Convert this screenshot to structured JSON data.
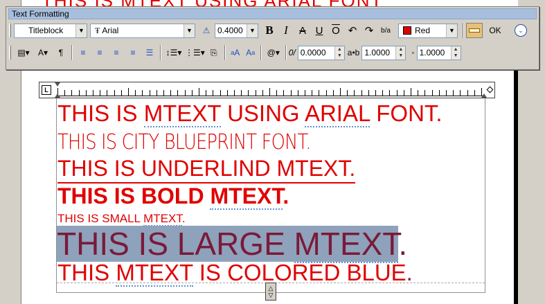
{
  "toolbar": {
    "title": "Text Formatting",
    "style_value": "Titleblock",
    "font_icon": "truetype-icon",
    "font_value": "Arial",
    "height_value": "0.4000",
    "bold": "B",
    "italic": "I",
    "strike": "A",
    "underline": "U",
    "overline": "O",
    "undo_icon": "undo-icon",
    "redo_icon": "redo-icon",
    "stack": "b/a",
    "color_value": "Red",
    "color_hex": "#e00000",
    "ok_label": "OK",
    "oblique_value": "0.0000",
    "tracking_label": "a•b",
    "tracking_value": "1.0000",
    "width_value": "1.0000",
    "uppercase_glyph": "A",
    "lowercase_glyph": "A",
    "symbol_glyph": "@"
  },
  "ruler": {
    "indent_label": "L"
  },
  "mtext": {
    "line1_a": "THIS IS ",
    "line1_b": "MTEXT",
    "line1_c": " USING ",
    "line1_d": "ARIAL",
    "line1_e": " FONT.",
    "line2": "THIS IS CITY BLUEPRINT FONT.",
    "line3": "THIS IS UNDERLIND MTEXT.",
    "line4_a": "THIS IS BOLD ",
    "line4_b": "MTEXT",
    "line4_c": ".",
    "line5_a": "THIS IS SMALL ",
    "line5_b": "MTEXT",
    "line5_c": ".",
    "line6_a": "THIS IS LARGE ",
    "line6_b": "MTEXT",
    "line6_c": ".",
    "line7_a": "THIS ",
    "line7_b": "MTEXT",
    "line7_c": " IS COLORED BLUE",
    "line7_d": ".",
    "highlight_color": "#8ea2bb"
  },
  "background_text": "THIS IS MTEXT USING ARIAL FONT"
}
